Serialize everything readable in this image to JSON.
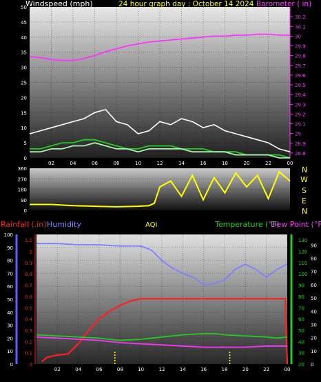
{
  "colors": {
    "background": "#000000",
    "white": "#ffffff",
    "yellow": "#ffff00",
    "magenta": "#ff33ff",
    "red": "#ff2020",
    "blue": "#8080ff",
    "green": "#22cc22",
    "light_green": "#b0f0b0"
  },
  "header": {
    "wind_label": "Windspeed (mph)",
    "title": "24 hour graph day : October 14 2024",
    "barometer_label": "Barometer ( in)"
  },
  "compass": [
    "N",
    "W",
    "S",
    "E",
    "N"
  ],
  "bottom_labels": {
    "rainfall": "Rainfall (.in)",
    "humidity": "Humidity",
    "aqi": "AQI",
    "temperature": "Temperature (°F)",
    "dew_point": "Dew Point (°F)"
  },
  "chart_data": [
    {
      "type": "line",
      "name": "wind_and_barometer",
      "x_ticks": [
        "02",
        "04",
        "06",
        "08",
        "10",
        "12",
        "14",
        "16",
        "18",
        "20",
        "22",
        "00"
      ],
      "xlim": [
        0,
        24
      ],
      "y_left": {
        "label": "Windspeed (mph)",
        "ticks": [
          "0",
          "5",
          "10",
          "15",
          "20",
          "25",
          "30",
          "35",
          "40",
          "45",
          "50"
        ],
        "ylim": [
          0,
          50
        ]
      },
      "y_right": {
        "label": "Barometer ( in)",
        "ticks": [
          "28.8",
          "28.9",
          "29",
          "29.1",
          "29.2",
          "29.3",
          "29.4",
          "29.5",
          "29.6",
          "29.7",
          "29.8",
          "29.9",
          "30",
          "30.1",
          "30.2"
        ],
        "ylim": [
          28.75,
          30.3
        ]
      },
      "series": [
        {
          "key": "barometer",
          "axis": "right",
          "color": "#ff33ff",
          "x": [
            0,
            1,
            2,
            3,
            4,
            5,
            6,
            7,
            8,
            9,
            10,
            11,
            12,
            13,
            14,
            15,
            16,
            17,
            18,
            19,
            20,
            21,
            22,
            23,
            24
          ],
          "y": [
            29.79,
            29.78,
            29.76,
            29.75,
            29.75,
            29.77,
            29.8,
            29.84,
            29.87,
            29.9,
            29.92,
            29.94,
            29.95,
            29.96,
            29.97,
            29.98,
            29.99,
            30.0,
            30.0,
            30.01,
            30.01,
            30.02,
            30.02,
            30.01,
            30.01
          ]
        },
        {
          "key": "wind_gust",
          "axis": "left",
          "color": "#ffffff",
          "x": [
            0,
            1,
            2,
            3,
            4,
            5,
            6,
            7,
            8,
            9,
            10,
            11,
            12,
            13,
            14,
            15,
            16,
            17,
            18,
            19,
            20,
            21,
            22,
            23,
            24
          ],
          "y": [
            8,
            9,
            10,
            11,
            12,
            13,
            15,
            16,
            12,
            11,
            8,
            9,
            12,
            11,
            13,
            12,
            10,
            11,
            9,
            8,
            7,
            6,
            5,
            3,
            2
          ]
        },
        {
          "key": "wind_avg",
          "axis": "left",
          "color": "#22cc22",
          "x": [
            0,
            1,
            2,
            3,
            4,
            5,
            6,
            7,
            8,
            9,
            10,
            11,
            12,
            13,
            14,
            15,
            16,
            17,
            18,
            19,
            20,
            21,
            22,
            23,
            24
          ],
          "y": [
            3,
            3,
            4,
            5,
            5,
            6,
            6,
            5,
            4,
            3,
            3,
            4,
            4,
            4,
            3,
            3,
            3,
            2,
            2,
            2,
            1,
            1,
            1,
            1,
            0
          ]
        },
        {
          "key": "wind_speed",
          "axis": "left",
          "color": "#b0f0b0",
          "x": [
            0,
            1,
            2,
            3,
            4,
            5,
            6,
            7,
            8,
            9,
            10,
            11,
            12,
            13,
            14,
            15,
            16,
            17,
            18,
            19,
            20,
            21,
            22,
            23,
            24
          ],
          "y": [
            2,
            2,
            3,
            3,
            4,
            4,
            5,
            4,
            3,
            3,
            2,
            3,
            3,
            3,
            3,
            2,
            2,
            2,
            2,
            1,
            1,
            1,
            1,
            0,
            0
          ]
        }
      ]
    },
    {
      "type": "line",
      "name": "wind_direction",
      "x_ticks": [
        "02",
        "04",
        "06",
        "08",
        "10",
        "12",
        "14",
        "16",
        "18",
        "20",
        "22",
        "00"
      ],
      "xlim": [
        0,
        24
      ],
      "y_left": {
        "ticks": [
          "0",
          "90",
          "180",
          "270",
          "360"
        ],
        "ylim": [
          0,
          360
        ]
      },
      "series": [
        {
          "key": "direction",
          "color": "#ffff00",
          "x": [
            0,
            2,
            4,
            6,
            8,
            10,
            11,
            11.5,
            12,
            13,
            14,
            15,
            16,
            17,
            18,
            19,
            20,
            21,
            22,
            23,
            24
          ],
          "y": [
            50,
            50,
            40,
            35,
            30,
            35,
            40,
            60,
            200,
            250,
            120,
            300,
            90,
            280,
            150,
            320,
            200,
            300,
            100,
            330,
            250
          ]
        }
      ]
    },
    {
      "type": "line",
      "name": "rain_humidity_temp",
      "x_ticks": [
        "02",
        "04",
        "06",
        "08",
        "10",
        "12",
        "14",
        "16",
        "18",
        "20",
        "22",
        "00"
      ],
      "xlim": [
        0,
        24
      ],
      "y_humidity": {
        "ticks": [
          "0",
          "10",
          "20",
          "30",
          "40",
          "50",
          "60",
          "70",
          "80",
          "90",
          "100"
        ],
        "ylim": [
          0,
          100
        ]
      },
      "y_rain": {
        "ticks": [
          "0",
          "0.1",
          "0.2",
          "0.3",
          "0.4",
          "0.5",
          "0.6",
          "0.7",
          "0.8",
          "0.9",
          "1",
          "1.1"
        ],
        "ylim": [
          0,
          1.15
        ]
      },
      "y_temp": {
        "ticks": [
          "20",
          "30",
          "40",
          "50",
          "60",
          "70",
          "80",
          "90",
          "100",
          "110",
          "120",
          "130"
        ],
        "ylim": [
          20,
          135
        ]
      },
      "y_dew": {
        "ticks": [
          "0",
          "10",
          "20",
          "30",
          "40",
          "50",
          "60",
          "70",
          "80",
          "90"
        ],
        "ylim": [
          0,
          98
        ]
      },
      "series": [
        {
          "key": "humidity",
          "axis": "humidity",
          "color": "#8080ff",
          "x": [
            0,
            2,
            4,
            6,
            8,
            9,
            10,
            11,
            12,
            13,
            14,
            15,
            16,
            17,
            18,
            19,
            20,
            21,
            22,
            23,
            24
          ],
          "y": [
            93,
            93,
            92,
            92,
            91,
            91,
            91,
            88,
            80,
            74,
            70,
            67,
            61,
            62,
            65,
            73,
            77,
            73,
            67,
            73,
            77
          ]
        },
        {
          "key": "rainfall",
          "axis": "rain",
          "color": "#ff2020",
          "x": [
            0.5,
            1,
            2,
            3,
            4,
            5,
            6,
            7,
            8,
            9,
            10,
            11,
            12,
            13,
            14,
            15,
            16,
            17,
            18,
            19,
            20,
            21,
            22,
            23.8,
            24
          ],
          "y": [
            0.02,
            0.06,
            0.08,
            0.09,
            0.18,
            0.3,
            0.4,
            0.47,
            0.52,
            0.56,
            0.58,
            0.58,
            0.58,
            0.58,
            0.58,
            0.58,
            0.58,
            0.58,
            0.58,
            0.58,
            0.58,
            0.58,
            0.58,
            0.58,
            0.0
          ]
        },
        {
          "key": "temperature",
          "axis": "temp",
          "color": "#22cc22",
          "x": [
            0,
            2,
            4,
            6,
            8,
            10,
            12,
            14,
            16,
            17,
            18,
            20,
            22,
            23,
            24
          ],
          "y": [
            46,
            45,
            44,
            43,
            41,
            42,
            44,
            46,
            47,
            47,
            46,
            45,
            44,
            43,
            44
          ]
        },
        {
          "key": "dew_point",
          "axis": "temp",
          "color": "#ff33ff",
          "x": [
            0,
            2,
            4,
            6,
            8,
            10,
            12,
            14,
            16,
            18,
            20,
            22,
            24
          ],
          "y": [
            44,
            43,
            42,
            41,
            39,
            38,
            37,
            36,
            35,
            35,
            35,
            36,
            36
          ]
        },
        {
          "key": "aqi_markers",
          "axis": "none",
          "color": "#ffff00",
          "x": [
            7.5,
            18.5
          ],
          "y": [
            0,
            0
          ]
        }
      ]
    }
  ]
}
